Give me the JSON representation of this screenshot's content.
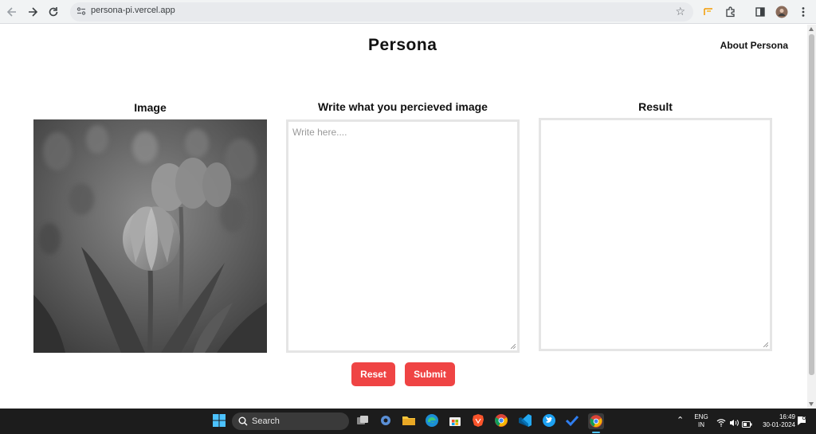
{
  "browser": {
    "url": "persona-pi.vercel.app"
  },
  "header": {
    "brand": "Persona",
    "about_link": "About Persona"
  },
  "columns": {
    "image_title": "Image",
    "input_title": "Write what you percieved image",
    "input_placeholder": "Write here....",
    "result_title": "Result"
  },
  "actions": {
    "reset_label": "Reset",
    "submit_label": "Submit"
  },
  "colors": {
    "accent_button": "#ef4444"
  },
  "taskbar": {
    "search_label": "Search",
    "lang_line1": "ENG",
    "lang_line2": "IN",
    "time": "16:49",
    "date": "30-01-2024"
  }
}
